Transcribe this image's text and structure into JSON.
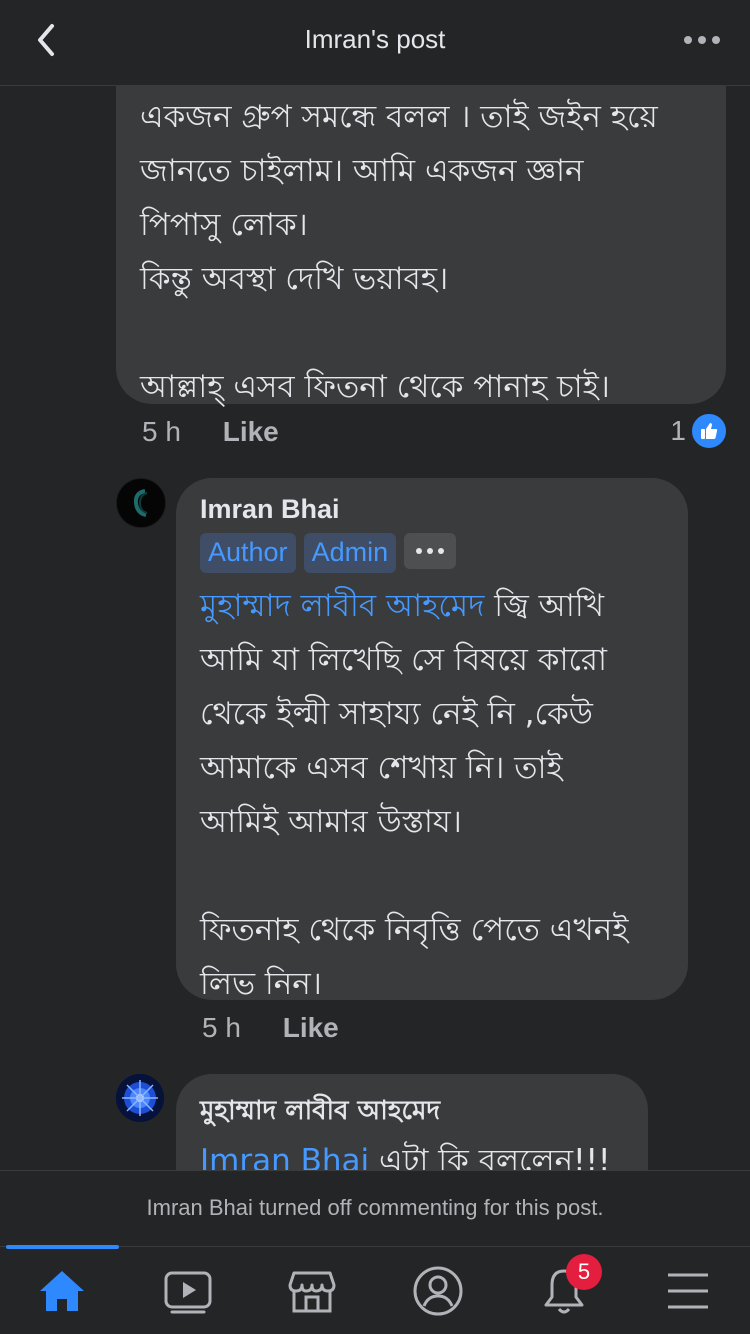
{
  "header": {
    "title": "Imran's post"
  },
  "comment1": {
    "text": "একজন গ্রুপ সমন্ধে বলল । তাই জইন হয়ে\nজানতে চাইলাম। আমি একজন জ্ঞান\nপিপাসু লোক।\nকিন্তু অবস্থা দেখি ভয়াবহ।\n\nআল্লাহ্ এসব ফিতনা থেকে পানাহ চাই।",
    "time": "5 h",
    "like_label": "Like",
    "reaction_count": "1"
  },
  "comment2": {
    "author": "Imran Bhai",
    "badges": [
      "Author",
      "Admin"
    ],
    "mention": "মুহাম্মাদ লাবীব আহমেদ",
    "text": " জ্বি আখি\nআমি যা লিখেছি সে বিষয়ে কারো\nথেকে ইল্মী সাহায্য নেই নি ,কেউ\nআমাকে এসব শেখায় নি। তাই\nআমিই আমার উস্তায।\n\nফিতনাহ থেকে নিবৃত্তি পেতে এখনই\nলিভ নিন।",
    "time": "5 h",
    "like_label": "Like"
  },
  "comment3": {
    "author": "মুহাম্মাদ লাবীব আহমেদ",
    "mention": "Imran Bhai",
    "text": " এটা কি বললেন!!!"
  },
  "notice": {
    "name": "Imran Bhai",
    "text": " turned off commenting for this post."
  },
  "tabbar": {
    "items": [
      "home-icon",
      "video-icon",
      "marketplace-icon",
      "profile-icon",
      "notifications-icon",
      "menu-icon"
    ],
    "notification_count": "5"
  },
  "colors": {
    "background": "#242526",
    "bubble": "#3a3b3c",
    "accent": "#2e89ff",
    "notification": "#e41e3f"
  }
}
